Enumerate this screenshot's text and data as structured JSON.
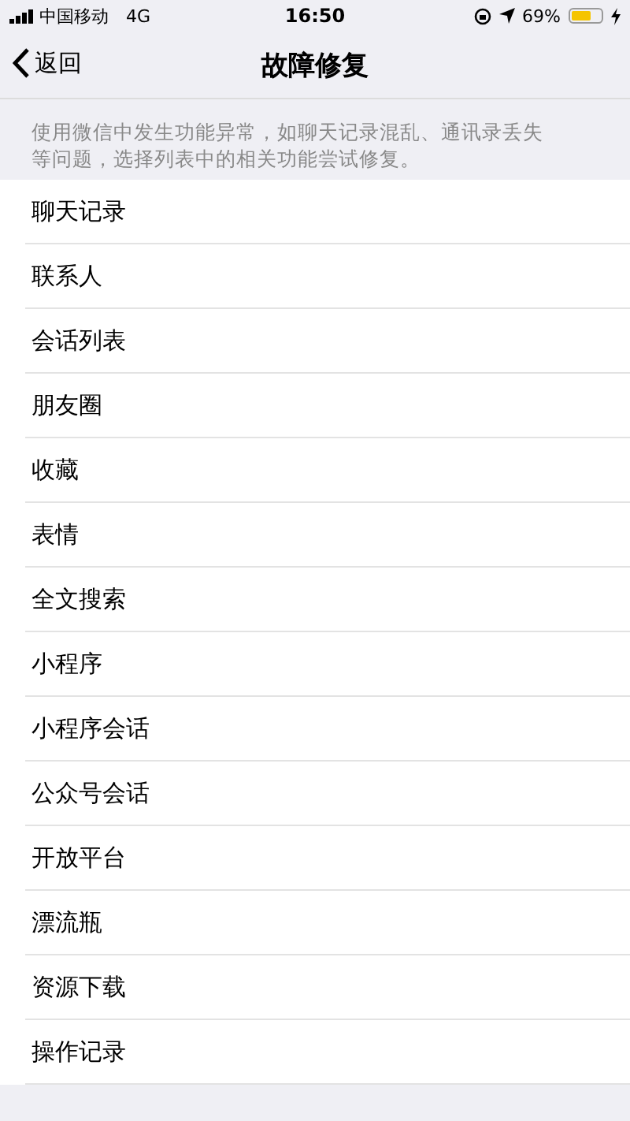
{
  "status_bar": {
    "carrier": "中国移动",
    "network": "4G",
    "time": "16:50",
    "battery_percent": "69%",
    "battery": {
      "level": 0.69,
      "charging": true
    }
  },
  "nav": {
    "back": "返回",
    "title": "故障修复"
  },
  "description": "使用微信中发生功能异常，如聊天记录混乱、通讯录丢失等问题，选择列表中的相关功能尝试修复。",
  "items": [
    {
      "label": "聊天记录"
    },
    {
      "label": "联系人"
    },
    {
      "label": "会话列表"
    },
    {
      "label": "朋友圈"
    },
    {
      "label": "收藏"
    },
    {
      "label": "表情"
    },
    {
      "label": "全文搜索"
    },
    {
      "label": "小程序"
    },
    {
      "label": "小程序会话"
    },
    {
      "label": "公众号会话"
    },
    {
      "label": "开放平台"
    },
    {
      "label": "漂流瓶"
    },
    {
      "label": "资源下载"
    },
    {
      "label": "操作记录"
    }
  ]
}
